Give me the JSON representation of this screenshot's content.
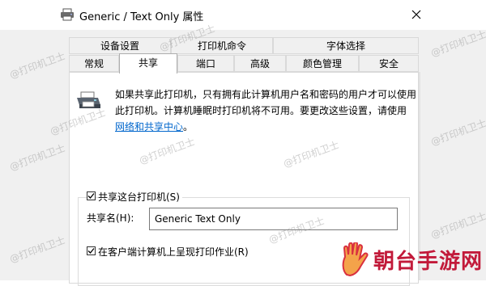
{
  "window": {
    "title": "Generic / Text Only 属性",
    "close_label": "×"
  },
  "tabs": {
    "row1": [
      {
        "label": "设备设置"
      },
      {
        "label": "打印机命令"
      },
      {
        "label": "字体选择"
      }
    ],
    "row2": [
      {
        "label": "常规"
      },
      {
        "label": "共享"
      },
      {
        "label": "端口"
      },
      {
        "label": "高级"
      },
      {
        "label": "颜色管理"
      },
      {
        "label": "安全"
      }
    ],
    "active": "共享"
  },
  "sharing": {
    "info_text": "如果共享此打印机，只有拥有此计算机用户名和密码的用户才可以使用此打印机。计算机睡眠时打印机将不可用。要更改这些设置，请使用",
    "info_link": "网络和共享中心",
    "info_suffix": "。",
    "share_checkbox": {
      "label": "共享这台打印机(S)",
      "checked": true
    },
    "share_name": {
      "label": "共享名(H):",
      "value": "Generic  Text Only"
    },
    "render_checkbox": {
      "label": "在客户端计算机上呈现打印作业(R)",
      "checked": true
    }
  },
  "watermarks": {
    "text": "@打印机卫士",
    "brand": "朝台手游网"
  },
  "icons": {
    "title": "printer-icon",
    "info": "printer-icon",
    "close": "close-icon",
    "check": "checkmark-icon",
    "brand": "hand-logo-icon"
  }
}
